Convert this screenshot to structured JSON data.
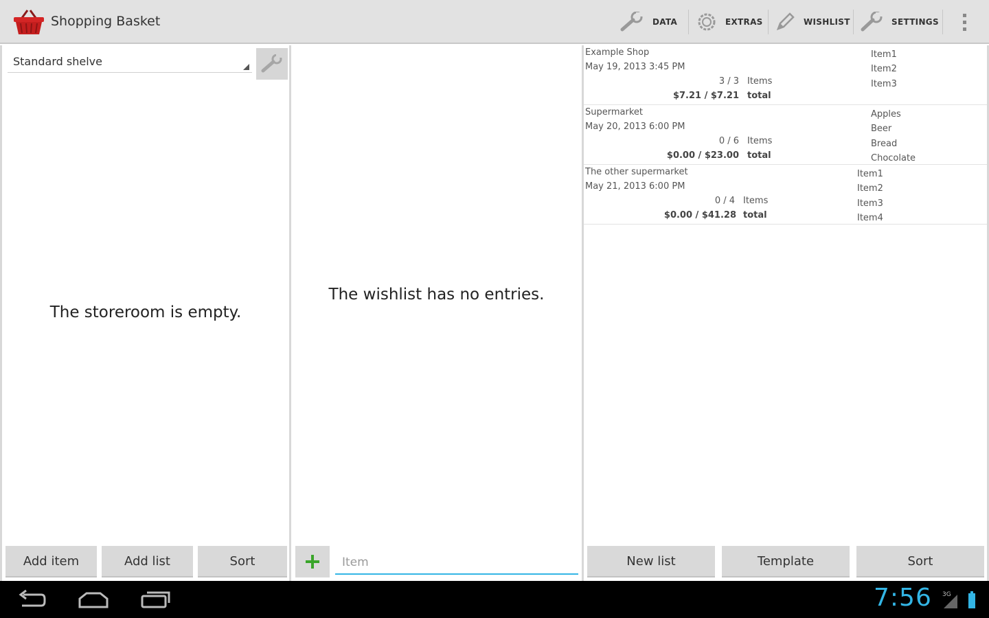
{
  "app": {
    "title": "Shopping Basket"
  },
  "actionbar": {
    "actions": [
      {
        "label": "DATA",
        "icon": "wrench-icon"
      },
      {
        "label": "EXTRAS",
        "icon": "gear-icon"
      },
      {
        "label": "WISHLIST",
        "icon": "pencil-icon"
      },
      {
        "label": "SETTINGS",
        "icon": "wrench-icon"
      }
    ]
  },
  "storeroom": {
    "shelf_selected": "Standard shelve",
    "empty_message": "The storeroom is empty.",
    "buttons": {
      "add_item": "Add item",
      "add_list": "Add list",
      "sort": "Sort"
    }
  },
  "wishlist": {
    "empty_message": "The wishlist has no entries.",
    "input_placeholder": "Item",
    "add_icon": "plus-icon"
  },
  "lists": {
    "entries": [
      {
        "shop": "Example Shop",
        "date": "May 19, 2013 3:45 PM",
        "count": "3 / 3",
        "count_label": "Items",
        "total": "$7.21 / $7.21",
        "total_label": "total",
        "items": [
          "Item1",
          "Item2",
          "Item3"
        ]
      },
      {
        "shop": "Supermarket",
        "date": "May 20, 2013 6:00 PM",
        "count": "0 / 6",
        "count_label": "Items",
        "total": "$0.00 / $23.00",
        "total_label": "total",
        "items": [
          "Apples",
          "Beer",
          "Bread",
          "Chocolate"
        ]
      },
      {
        "shop": "The other supermarket",
        "date": "May 21, 2013 6:00 PM",
        "count": "0 / 4",
        "count_label": "Items",
        "total": "$0.00 / $41.28",
        "total_label": "total",
        "items": [
          "Item1",
          "Item2",
          "Item3",
          "Item4"
        ]
      }
    ],
    "buttons": {
      "new_list": "New list",
      "template": "Template",
      "sort": "Sort"
    }
  },
  "statusbar": {
    "time": "7:56",
    "network": "3G"
  },
  "colors": {
    "accent": "#33b5e5",
    "actionbar": "#e2e2e2",
    "add_green": "#3aa52a",
    "basket_red": "#cc1f1f"
  }
}
